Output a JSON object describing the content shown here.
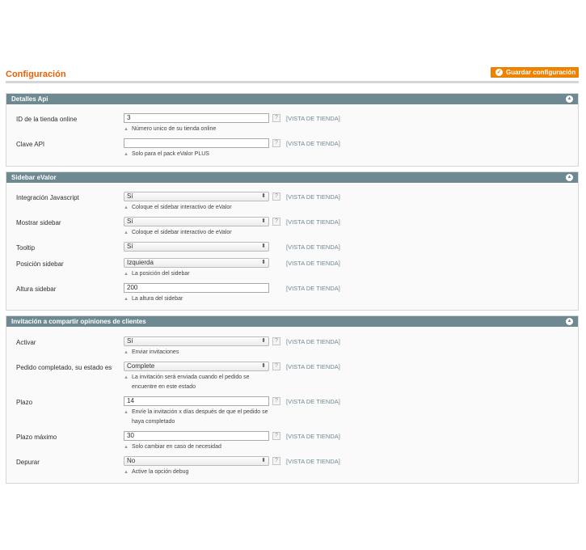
{
  "page": {
    "title": "Configuración",
    "save_label": "Guardar configuración"
  },
  "scope_label": "[VISTA DE TIENDA]",
  "help_glyph": "?",
  "sections": [
    {
      "title": "Detalles Api",
      "rows": [
        {
          "label": "ID de la tienda online",
          "value": "3",
          "note": "Número unico de su tienda online"
        },
        {
          "label": "Clave API",
          "value": "",
          "note": "Solo para el pack eValor PLUS"
        }
      ]
    },
    {
      "title": "Sidebar eValor",
      "rows": [
        {
          "label": "Integración Javascript",
          "value": "Sí",
          "note": "Coloque el sidebar interactivo de eValor"
        },
        {
          "label": "Mostrar sidebar",
          "value": "Sí",
          "note": "Coloque el sidebar interactivo de eValor"
        },
        {
          "label": "Tooltip",
          "value": "Sí"
        },
        {
          "label": "Posición sidebar",
          "value": "Izquierda",
          "note": "La posición del sidebar"
        },
        {
          "label": "Altura sidebar",
          "value": "200",
          "note": "La altura del sidebar"
        }
      ]
    },
    {
      "title": "Invitación a compartir opiniones de clientes",
      "rows": [
        {
          "label": "Activar",
          "value": "Sí",
          "note": "Enviar invitaciones"
        },
        {
          "label": "Pedido completado, su estado es",
          "value": "Complete",
          "note_line1": "La invitación será enviada cuando el pedido se",
          "note_line2": "encuentre en este estado"
        },
        {
          "label": "Plazo",
          "value": "14",
          "note_line1": "Envíe la invitación x días después de que el pedido se",
          "note_line2": "haya completado"
        },
        {
          "label": "Plazo máximo",
          "value": "30",
          "note": "Solo cambiar en caso de necesidad"
        },
        {
          "label": "Depurar",
          "value": "No",
          "note": "Active la opción debug"
        }
      ]
    }
  ]
}
